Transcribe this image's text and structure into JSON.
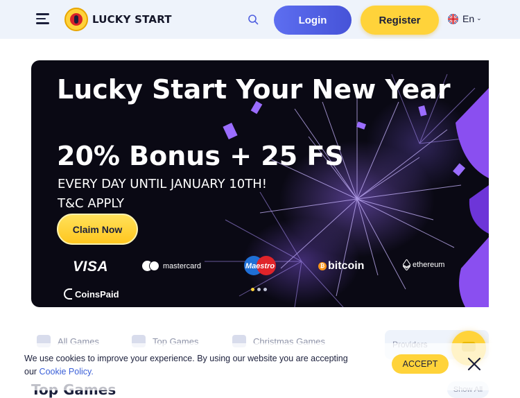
{
  "header": {
    "brand": "LUCKY START",
    "login_label": "Login",
    "register_label": "Register",
    "language": "En",
    "accent_color": "#5d6ef0",
    "register_color": "#ffd33a"
  },
  "banner": {
    "title": "Lucky Start Your New Year",
    "bonus": "20% Bonus + 25 FS",
    "line1": "EVERY DAY UNTIL JANUARY 10TH!",
    "line2": "T&C APPLY",
    "claim_label": "Claim Now",
    "payments": {
      "visa": "VISA",
      "mastercard": "mastercard",
      "maestro": "Maestro",
      "bitcoin": "bitcoin",
      "ethereum": "ethereum",
      "coinspaid": "CoinsPaid"
    },
    "slides_total": 3,
    "slide_active": 1
  },
  "tabs": {
    "all_games": "All Games",
    "top_games": "Top Games",
    "christmas_games": "Christmas Games",
    "providers": "Providers"
  },
  "section": {
    "title": "Top Games",
    "show_all": "Show All"
  },
  "cookie": {
    "text": "We use cookies to improve your experience. By using our website you are accepting our ",
    "link": "Cookie Policy.",
    "accept_label": "ACCEPT"
  }
}
